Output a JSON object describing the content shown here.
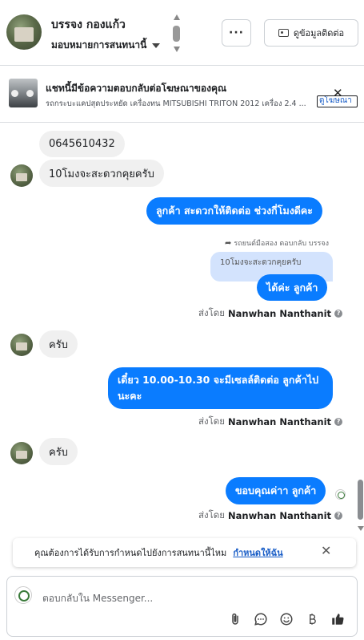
{
  "header": {
    "contact_name": "บรรจง กองแก้ว",
    "assign_label": "มอบหมายการสนทนานี้",
    "more_label": "···",
    "contact_info_label": "ดูข้อมูลติดต่อ"
  },
  "ad": {
    "title": "แชทนี้มีข้อความตอบกลับต่อโฆษณาของคุณ",
    "subtitle": "รถกระบะแคปสุดประหยัด เครื่องทน MITSUBISHI TRITON 2012 เครื่อง 2.4 ...",
    "link": "ดูโฆษณา",
    "close": "✕"
  },
  "messages": {
    "m1": "0645610432",
    "m2": "10โมงจะสะดวกคุยครับ",
    "m3": "ลูกค้า สะดวกให้ติดต่อ ช่วงกี่โมงดีคะ",
    "reply_meta": "รถยนต์มือสอง ตอบกลับ บรรจง",
    "quoted": "10โมงจะสะดวกคุยครับ",
    "m4": "ได้ค่ะ ลูกค้า",
    "m5": "ครับ",
    "m6": "เดี๋ยว 10.00-10.30 จะมีเซลล์ติดต่อ ลูกค้าไปนะคะ",
    "m7": "ครับ",
    "m8": "ขอบคุณค่าา ลูกค้า"
  },
  "sent_by": {
    "prefix": "ส่งโดย",
    "name": "Nanwhan Nanthanit",
    "info": "?"
  },
  "assign_prompt": {
    "text": "คุณต้องการได้รับการกำหนดไปยังการสนทนานี้ไหม",
    "link": "กำหนดให้ฉัน",
    "close": "✕"
  },
  "composer": {
    "placeholder": "ตอบกลับใน Messenger..."
  },
  "colors": {
    "outgoing_bubble": "#0a7cff",
    "incoming_bubble": "#f0f0f0",
    "link": "#1a5ec7"
  }
}
